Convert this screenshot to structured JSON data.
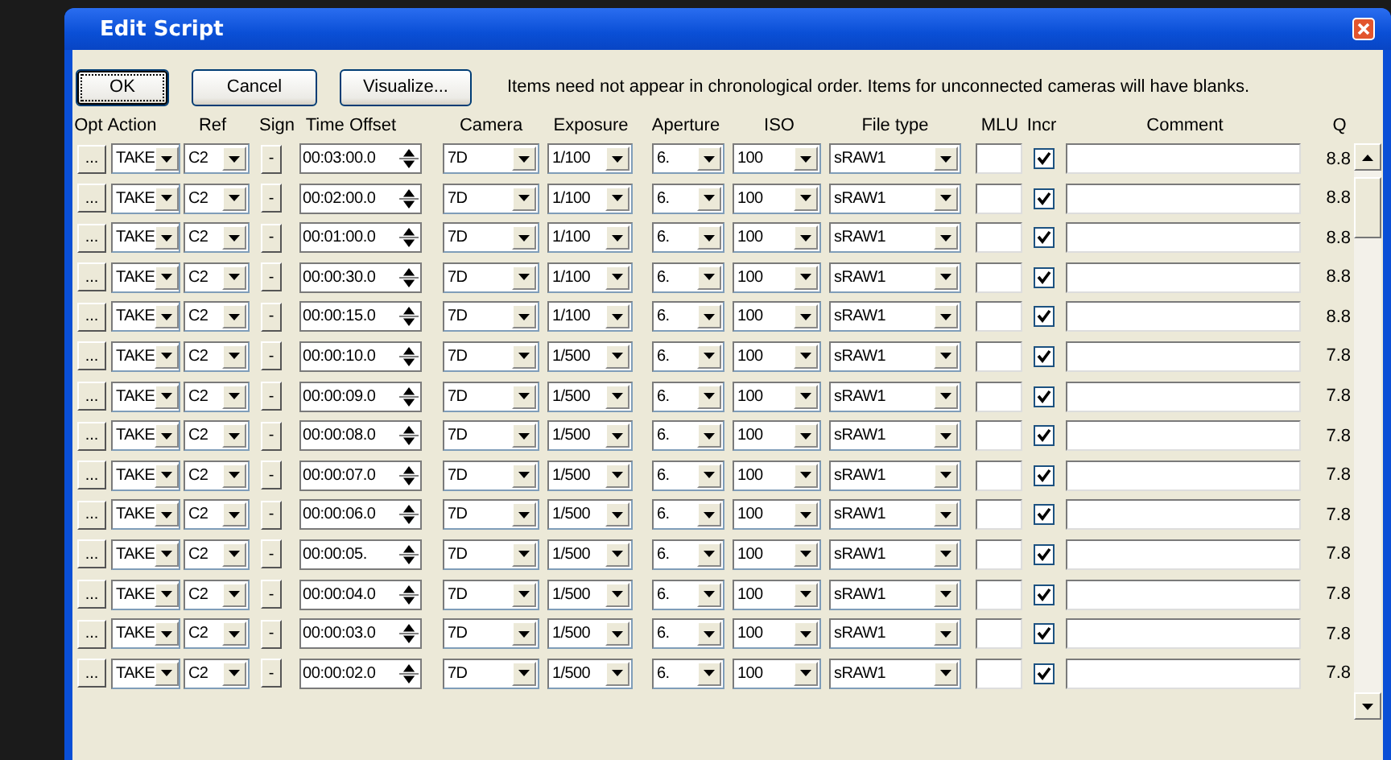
{
  "window": {
    "title": "Edit Script"
  },
  "buttons": [
    {
      "label": "OK",
      "focused": true
    },
    {
      "label": "Cancel",
      "focused": false
    },
    {
      "label": "Visualize...",
      "focused": false
    }
  ],
  "note": "Items need not appear in chronological order.  Items for unconnected cameras will have blanks.",
  "columns": [
    "Opt",
    "Action",
    "Ref",
    "Sign",
    "Time Offset",
    "Camera",
    "Exposure",
    "Aperture",
    "ISO",
    "File type",
    "MLU",
    "Incr",
    "Comment",
    "Q"
  ],
  "rows": [
    {
      "opt": "...",
      "action": "TAKE",
      "ref": "C2",
      "sign": "-",
      "time": "00:03:00.0",
      "camera": "7D",
      "exposure": "1/100",
      "aperture": "6.",
      "iso": "100",
      "file_type": "sRAW1",
      "incr": true,
      "q": "8.8"
    },
    {
      "opt": "...",
      "action": "TAKE",
      "ref": "C2",
      "sign": "-",
      "time": "00:02:00.0",
      "camera": "7D",
      "exposure": "1/100",
      "aperture": "6.",
      "iso": "100",
      "file_type": "sRAW1",
      "incr": true,
      "q": "8.8"
    },
    {
      "opt": "...",
      "action": "TAKE",
      "ref": "C2",
      "sign": "-",
      "time": "00:01:00.0",
      "camera": "7D",
      "exposure": "1/100",
      "aperture": "6.",
      "iso": "100",
      "file_type": "sRAW1",
      "incr": true,
      "q": "8.8"
    },
    {
      "opt": "...",
      "action": "TAKE",
      "ref": "C2",
      "sign": "-",
      "time": "00:00:30.0",
      "camera": "7D",
      "exposure": "1/100",
      "aperture": "6.",
      "iso": "100",
      "file_type": "sRAW1",
      "incr": true,
      "q": "8.8"
    },
    {
      "opt": "...",
      "action": "TAKE",
      "ref": "C2",
      "sign": "-",
      "time": "00:00:15.0",
      "camera": "7D",
      "exposure": "1/100",
      "aperture": "6.",
      "iso": "100",
      "file_type": "sRAW1",
      "incr": true,
      "q": "8.8"
    },
    {
      "opt": "...",
      "action": "TAKE",
      "ref": "C2",
      "sign": "-",
      "time": "00:00:10.0",
      "camera": "7D",
      "exposure": "1/500",
      "aperture": "6.",
      "iso": "100",
      "file_type": "sRAW1",
      "incr": true,
      "q": "7.8"
    },
    {
      "opt": "...",
      "action": "TAKE",
      "ref": "C2",
      "sign": "-",
      "time": "00:00:09.0",
      "camera": "7D",
      "exposure": "1/500",
      "aperture": "6.",
      "iso": "100",
      "file_type": "sRAW1",
      "incr": true,
      "q": "7.8"
    },
    {
      "opt": "...",
      "action": "TAKE",
      "ref": "C2",
      "sign": "-",
      "time": "00:00:08.0",
      "camera": "7D",
      "exposure": "1/500",
      "aperture": "6.",
      "iso": "100",
      "file_type": "sRAW1",
      "incr": true,
      "q": "7.8"
    },
    {
      "opt": "...",
      "action": "TAKE",
      "ref": "C2",
      "sign": "-",
      "time": "00:00:07.0",
      "camera": "7D",
      "exposure": "1/500",
      "aperture": "6.",
      "iso": "100",
      "file_type": "sRAW1",
      "incr": true,
      "q": "7.8"
    },
    {
      "opt": "...",
      "action": "TAKE",
      "ref": "C2",
      "sign": "-",
      "time": "00:00:06.0",
      "camera": "7D",
      "exposure": "1/500",
      "aperture": "6.",
      "iso": "100",
      "file_type": "sRAW1",
      "incr": true,
      "q": "7.8"
    },
    {
      "opt": "...",
      "action": "TAKE",
      "ref": "C2",
      "sign": "-",
      "time": "00:00:05.",
      "camera": "7D",
      "exposure": "1/500",
      "aperture": "6.",
      "iso": "100",
      "file_type": "sRAW1",
      "incr": true,
      "q": "7.8"
    },
    {
      "opt": "...",
      "action": "TAKE",
      "ref": "C2",
      "sign": "-",
      "time": "00:00:04.0",
      "camera": "7D",
      "exposure": "1/500",
      "aperture": "6.",
      "iso": "100",
      "file_type": "sRAW1",
      "incr": true,
      "q": "7.8"
    },
    {
      "opt": "...",
      "action": "TAKE",
      "ref": "C2",
      "sign": "-",
      "time": "00:00:03.0",
      "camera": "7D",
      "exposure": "1/500",
      "aperture": "6.",
      "iso": "100",
      "file_type": "sRAW1",
      "incr": true,
      "q": "7.8"
    },
    {
      "opt": "...",
      "action": "TAKE",
      "ref": "C2",
      "sign": "-",
      "time": "00:00:02.0",
      "camera": "7D",
      "exposure": "1/500",
      "aperture": "6.",
      "iso": "100",
      "file_type": "sRAW1",
      "incr": true,
      "q": "7.8"
    }
  ]
}
